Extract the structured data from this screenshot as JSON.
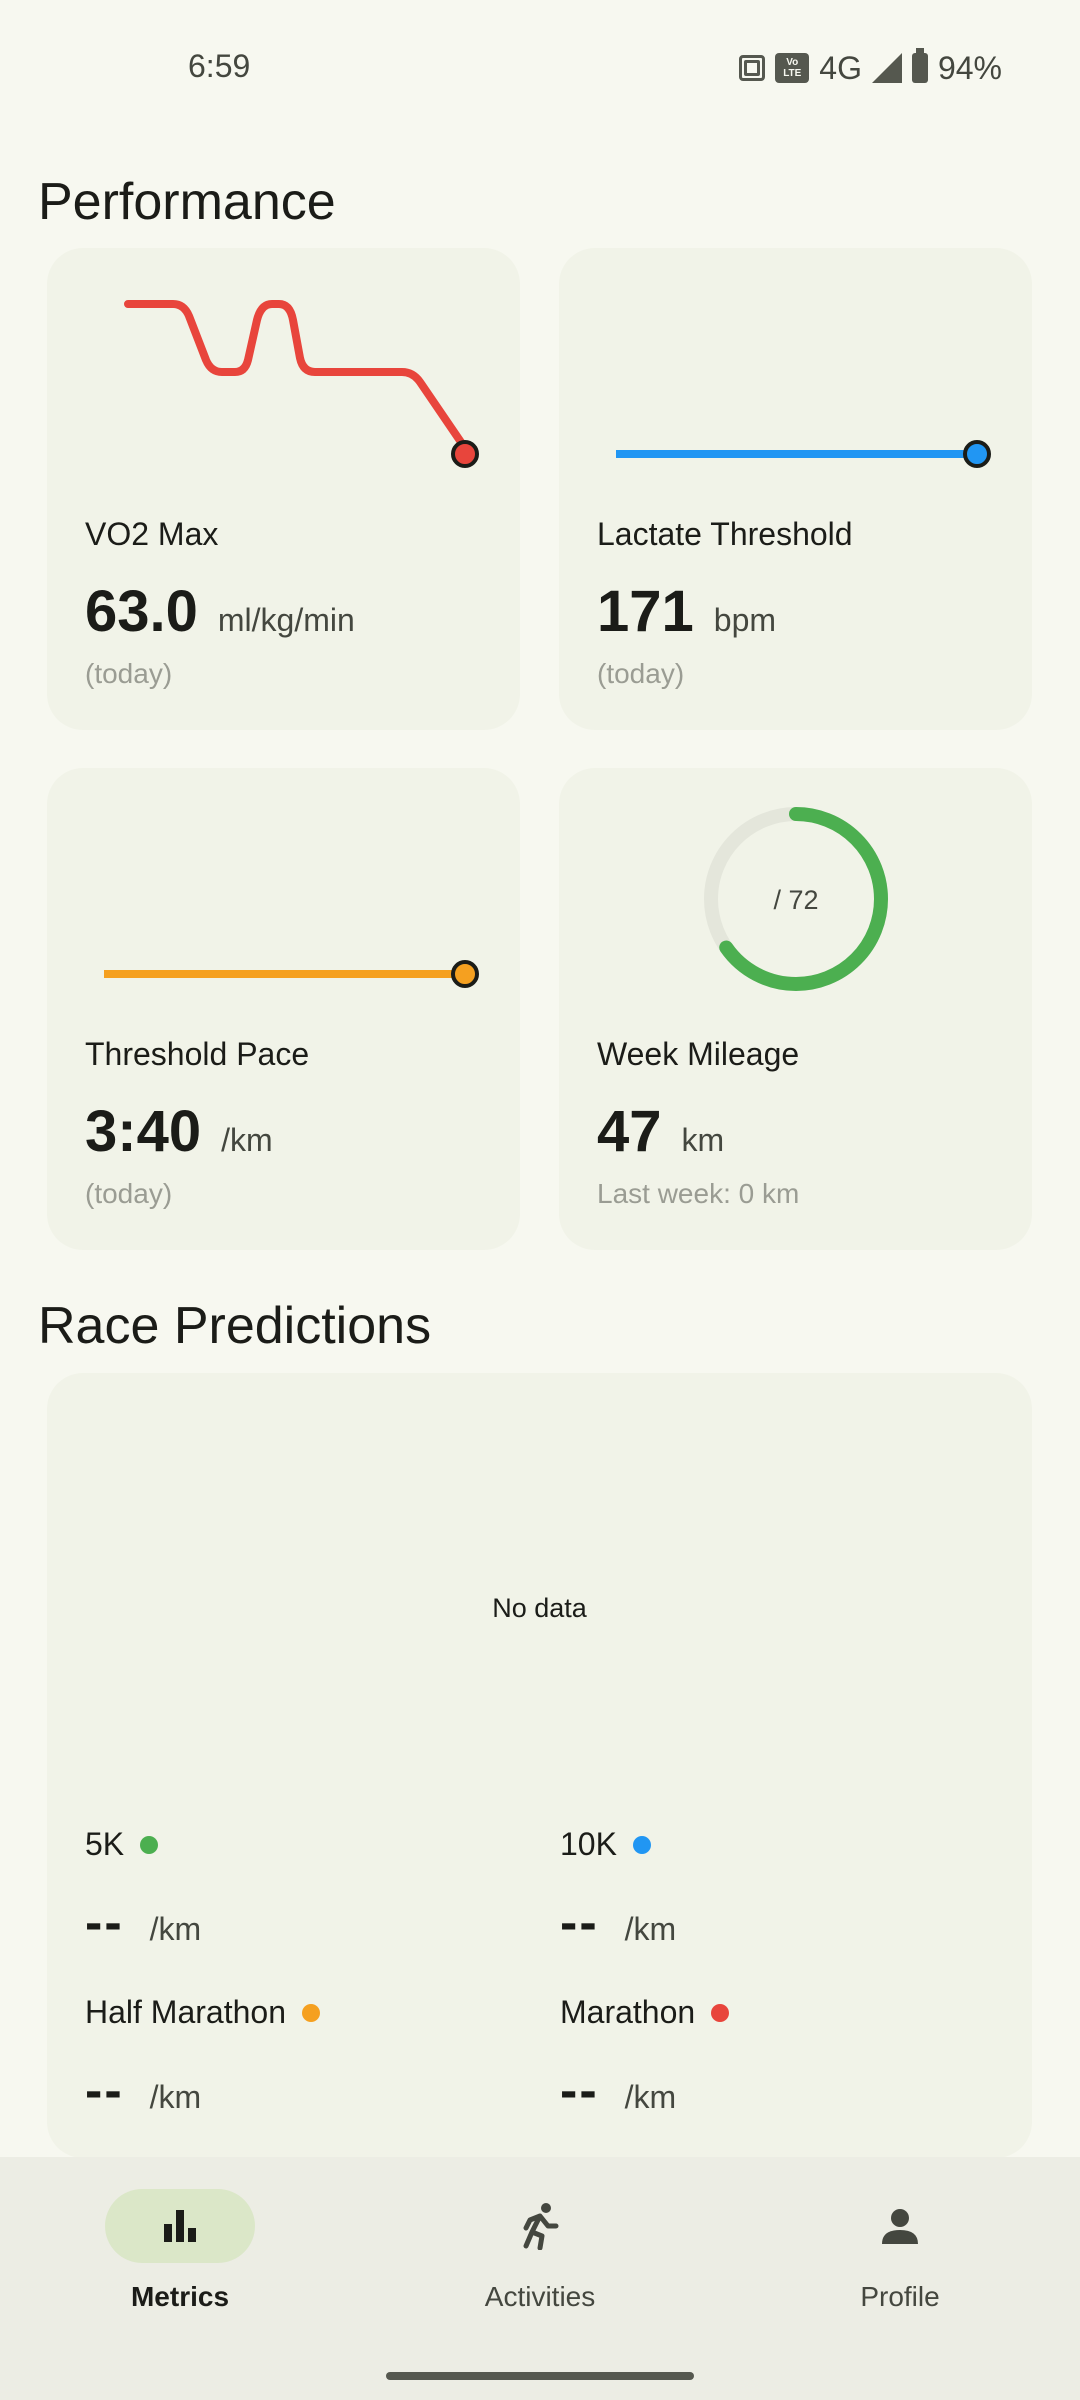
{
  "status_bar": {
    "time": "6:59",
    "network": "4G",
    "battery": "94%"
  },
  "performance": {
    "title": "Performance",
    "cards": [
      {
        "label": "VO2 Max",
        "value": "63.0",
        "unit": "ml/kg/min",
        "subtext": "(today)",
        "color": "#e8453c"
      },
      {
        "label": "Lactate Threshold",
        "value": "171",
        "unit": "bpm",
        "subtext": "(today)",
        "color": "#2196f3"
      },
      {
        "label": "Threshold Pace",
        "value": "3:40",
        "unit": "/km",
        "subtext": "(today)",
        "color": "#f5a020"
      },
      {
        "label": "Week Mileage",
        "value": "47",
        "unit": "km",
        "subtext": "Last week: 0 km",
        "ring_text": "/ 72",
        "ring_fraction": 0.653,
        "color": "#4caf50"
      }
    ]
  },
  "race_predictions": {
    "title": "Race Predictions",
    "empty_text": "No data",
    "items": [
      {
        "name": "5K",
        "value": "--",
        "unit": "/km",
        "color": "#4caf50"
      },
      {
        "name": "10K",
        "value": "--",
        "unit": "/km",
        "color": "#2196f3"
      },
      {
        "name": "Half Marathon",
        "value": "--",
        "unit": "/km",
        "color": "#f5a020"
      },
      {
        "name": "Marathon",
        "value": "--",
        "unit": "/km",
        "color": "#e8453c"
      }
    ]
  },
  "bottom_nav": {
    "items": [
      {
        "label": "Metrics",
        "icon": "bar-chart-icon",
        "active": true
      },
      {
        "label": "Activities",
        "icon": "running-icon",
        "active": false
      },
      {
        "label": "Profile",
        "icon": "person-icon",
        "active": false
      }
    ]
  }
}
